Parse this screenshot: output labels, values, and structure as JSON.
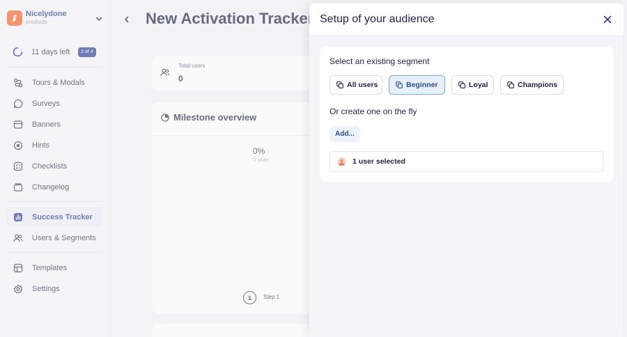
{
  "brand": {
    "name": "Nicelydone",
    "subtitle": "products"
  },
  "trial": {
    "days_left": "11 days left",
    "badge": "2 of 4"
  },
  "nav": {
    "group1": [
      {
        "label": "Tours & Modals",
        "icon": "route-icon"
      },
      {
        "label": "Surveys",
        "icon": "chat-bubble-icon"
      },
      {
        "label": "Banners",
        "icon": "banner-icon"
      },
      {
        "label": "Hints",
        "icon": "target-icon"
      },
      {
        "label": "Checklists",
        "icon": "checklist-icon"
      },
      {
        "label": "Changelog",
        "icon": "stack-icon"
      }
    ],
    "group2": [
      {
        "label": "Success Tracker",
        "icon": "bar-chart-icon",
        "active": true
      },
      {
        "label": "Users & Segments",
        "icon": "users-icon"
      }
    ],
    "group3": [
      {
        "label": "Templates",
        "icon": "template-icon"
      },
      {
        "label": "Settings",
        "icon": "gear-icon"
      }
    ]
  },
  "main": {
    "title": "New Activation Tracker",
    "stat": {
      "label": "Total users",
      "value": "0"
    },
    "milestone": {
      "title": "Milestone overview",
      "percent": "0%",
      "percent_sub": "0 user",
      "step_number": "1",
      "step_label": "Step 1"
    }
  },
  "modal": {
    "title": "Setup of your audience",
    "existing_label": "Select an existing segment",
    "segments": [
      {
        "label": "All users",
        "selected": false
      },
      {
        "label": "Beginner",
        "selected": true
      },
      {
        "label": "Loyal",
        "selected": false
      },
      {
        "label": "Champions",
        "selected": false
      }
    ],
    "create_label": "Or create one on the fly",
    "add_label": "Add...",
    "selected_summary": "1 user selected"
  },
  "colors": {
    "accent": "#2c3e8f",
    "brand_orange": "#f0642a",
    "selected_bg": "#e8f0fb"
  }
}
